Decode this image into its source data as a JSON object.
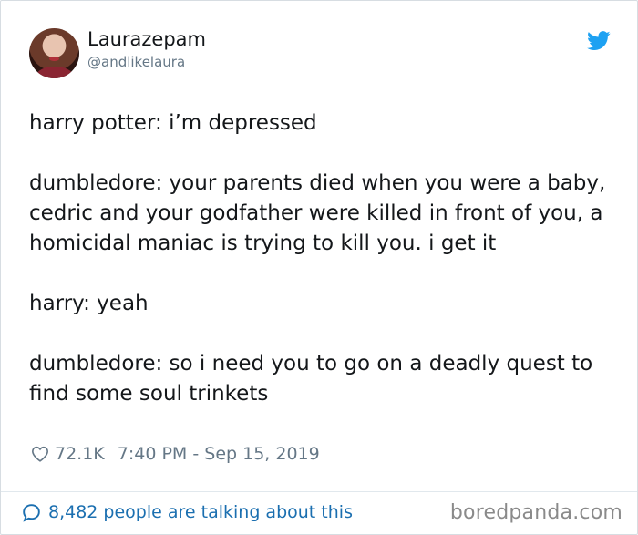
{
  "user": {
    "name": "Laurazepam",
    "handle": "@andlikelaura"
  },
  "tweet": {
    "paragraphs": [
      "harry potter: i’m depressed",
      "dumbledore: your parents died when you were a baby, cedric and your godfather were killed in front of you, a homicidal maniac is trying to kill you. i get it",
      "harry: yeah",
      "dumbledore: so i need you to go on a deadly quest to find some soul trinkets"
    ],
    "likes": "72.1K",
    "timestamp": "7:40 PM - Sep 15, 2019"
  },
  "footer": {
    "talking": "8,482 people are talking about this",
    "watermark": "boredpanda.com"
  },
  "colors": {
    "twitter_blue": "#1da1f2",
    "link_blue": "#1b6fb0",
    "meta_gray": "#657786"
  },
  "icons": {
    "brand": "twitter-bird-icon",
    "like": "heart-icon",
    "replies": "speech-bubble-icon"
  }
}
